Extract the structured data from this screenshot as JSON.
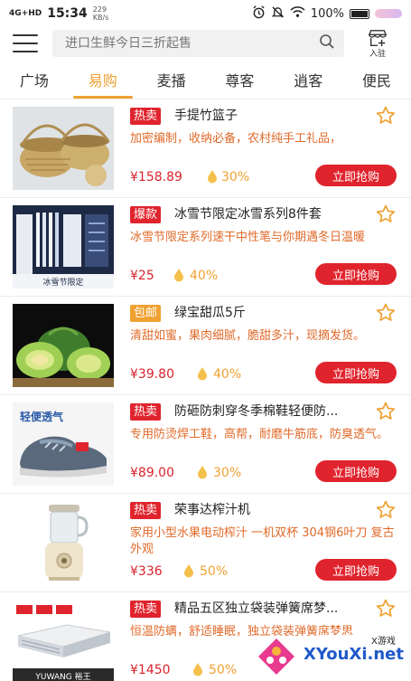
{
  "status_bar": {
    "network": "4G+HD",
    "time": "15:34",
    "speed_value": "229",
    "speed_unit": "KB/s",
    "battery": "100%"
  },
  "header": {
    "search_placeholder": "进口生鲜今日三折起售",
    "join_label": "入驻"
  },
  "tabs": [
    "广场",
    "易购",
    "麦播",
    "尊客",
    "逍客",
    "便民"
  ],
  "active_tab": "易购",
  "buy_label": "立即抢购",
  "products": [
    {
      "badge": "热卖",
      "badge_color": "#e0242d",
      "title": "手提竹篮子",
      "desc": "加密编制，收纳必备，农村纯手工礼品，",
      "price": "¥158.89",
      "percent": "30%"
    },
    {
      "badge": "爆款",
      "badge_color": "#e0242d",
      "title": "冰雪节限定冰雪系列8件套",
      "desc": "冰雪节限定系列速干中性笔与你期遇冬日温暖",
      "price": "¥25",
      "percent": "40%"
    },
    {
      "badge": "包邮",
      "badge_color": "#f0a132",
      "title": "绿宝甜瓜5斤",
      "desc": "清甜如蜜，果肉细腻，脆甜多汁，现摘发货。",
      "price": "¥39.80",
      "percent": "40%"
    },
    {
      "badge": "热卖",
      "badge_color": "#e0242d",
      "title": "防砸防刺穿冬季棉鞋轻便防...",
      "desc": "专用防烫焊工鞋，高帮，耐磨牛筋底，防臭透气。",
      "price": "¥89.00",
      "percent": "30%"
    },
    {
      "badge": "热卖",
      "badge_color": "#e0242d",
      "title": "荣事达榨汁机",
      "desc": "家用小型水果电动榨汁 一机双杯 304钢6叶刀 复古外观",
      "price": "¥336",
      "percent": "50%"
    },
    {
      "badge": "热卖",
      "badge_color": "#e0242d",
      "title": "精品五区独立袋装弹簧席梦...",
      "desc": "恒温防螨，舒适睡眠，独立袋装弹簧席梦思",
      "price": "¥1450",
      "percent": "50%"
    }
  ],
  "thumb_texts": {
    "pens_banner": "冰雪节限定",
    "shoe_text": "轻便透气",
    "mattress_brand": "YUWANG 裕王"
  },
  "watermark": {
    "main": "XYouXi.net",
    "small": "X游戏"
  }
}
